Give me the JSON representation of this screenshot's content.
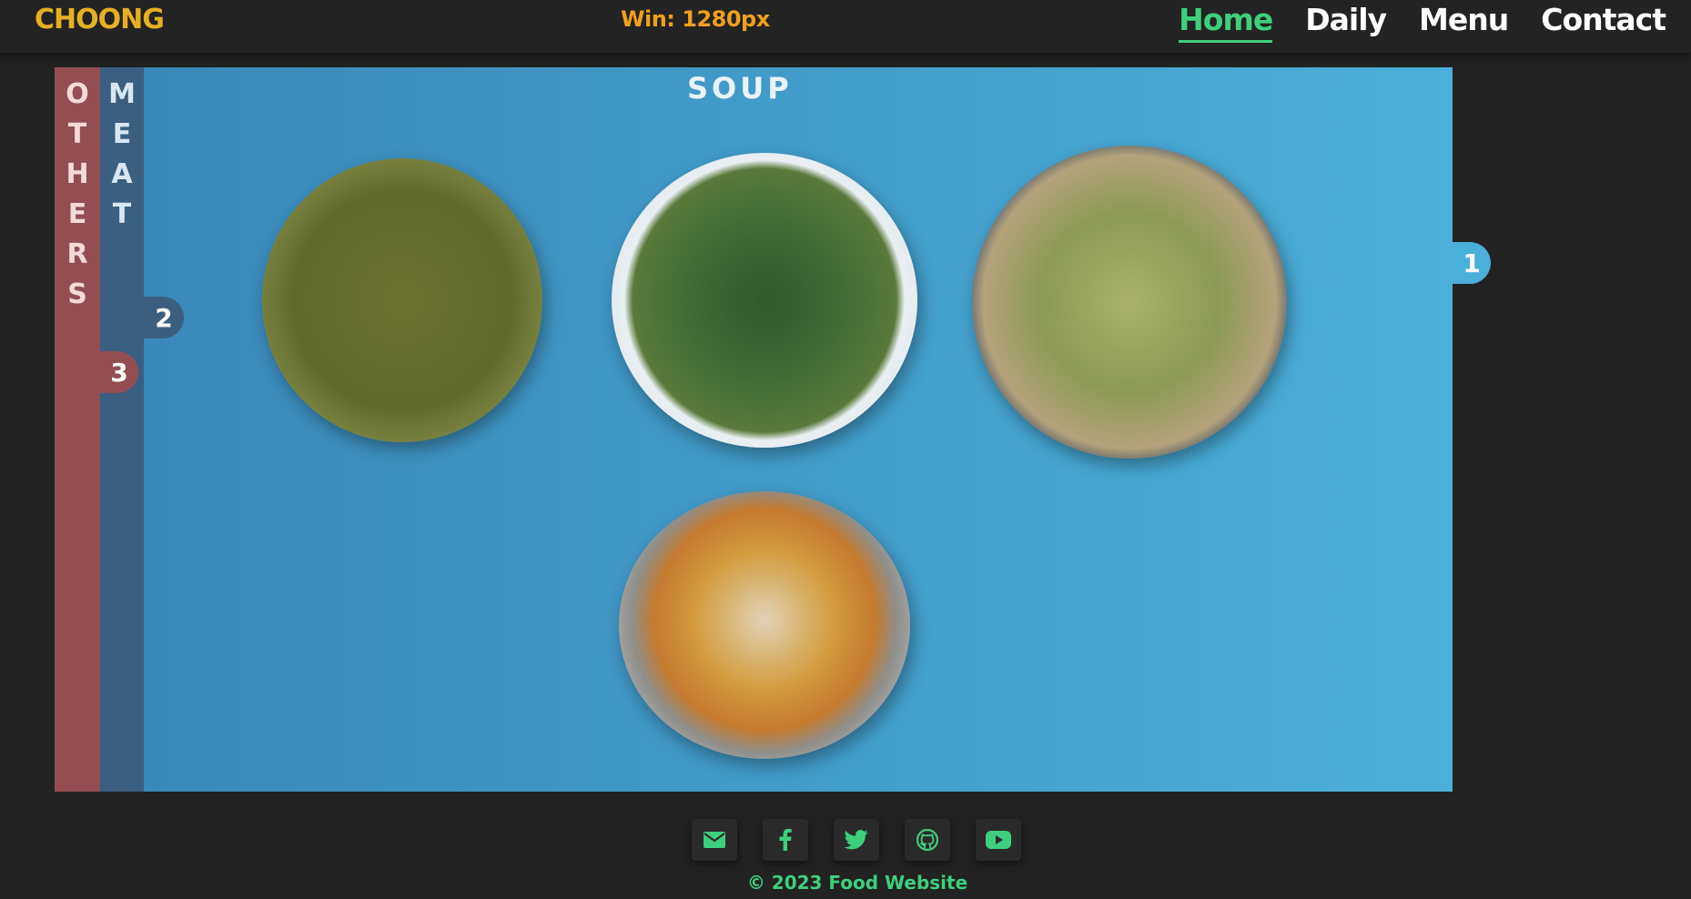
{
  "header": {
    "logo": "CHOONG",
    "window_label": "Win: 1280px",
    "nav": [
      {
        "label": "Home",
        "active": true
      },
      {
        "label": "Daily"
      },
      {
        "label": "Menu"
      },
      {
        "label": "Contact"
      }
    ]
  },
  "main": {
    "title": "SOUP",
    "tabs": [
      {
        "letters": [
          "O",
          "T",
          "H",
          "E",
          "R",
          "S"
        ],
        "number": "3",
        "color": "#944e53"
      },
      {
        "letters": [
          "M",
          "E",
          "A",
          "T"
        ],
        "number": "2",
        "color": "#3a5f80"
      },
      {
        "number": "1",
        "color": "#4aafd9"
      }
    ],
    "dishes": [
      "soup-bowl-1",
      "soup-bowl-2",
      "soup-bowl-3",
      "soup-bowl-4"
    ]
  },
  "footer": {
    "social_icons": [
      "envelope-icon",
      "facebook-icon",
      "twitter-icon",
      "github-icon",
      "youtube-icon"
    ],
    "accent_color": "#3ecf7c",
    "copyright": "© 2023 Food Website"
  }
}
